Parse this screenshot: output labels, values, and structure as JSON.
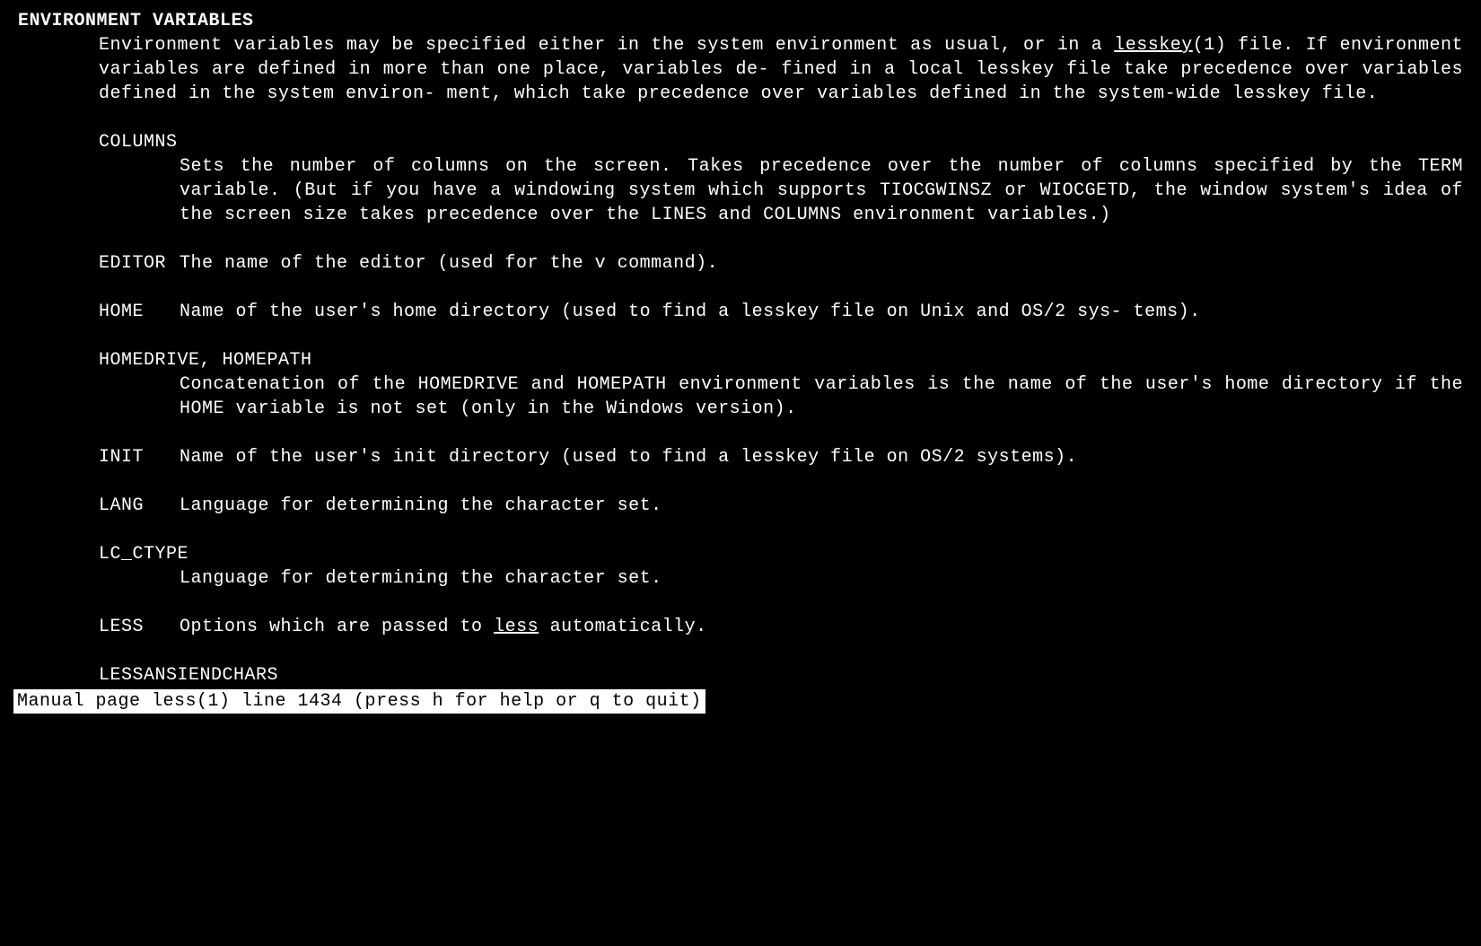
{
  "section_header": "ENVIRONMENT VARIABLES",
  "intro": {
    "part1": "Environment variables may be specified either in the system environment as  usual,  or  in  a  ",
    "link": "lesskey",
    "linknum": "(1)",
    "part2": "  file.  If environment variables are defined in more than one place, variables de‐ fined in a local lesskey file take precedence over variables defined in the  system  environ‐ ment, which take precedence over variables defined in the system-wide lesskey file."
  },
  "vars": {
    "columns": {
      "name": "COLUMNS",
      "desc": "Sets the number of columns on the screen.  Takes precedence over the number of columns specified  by  the  TERM variable.  (But if you have a windowing system which supports TIOCGWINSZ or WIOCGETD, the window system's idea of the screen size  takes  precedence over the LINES and COLUMNS environment variables.)"
    },
    "editor": {
      "name": "EDITOR",
      "desc": "The name of the editor (used for the v command)."
    },
    "home": {
      "name": "HOME",
      "desc": "Name  of  the user's home directory (used to find a lesskey file on Unix and OS/2 sys‐ tems)."
    },
    "homedrive": {
      "name": "HOMEDRIVE, HOMEPATH",
      "desc": "Concatenation of the HOMEDRIVE and HOMEPATH environment variables is the name  of  the user's home directory if the HOME variable is not set (only in the Windows version)."
    },
    "init": {
      "name": "INIT",
      "desc": "Name of the user's init directory (used to find a lesskey file on OS/2 systems)."
    },
    "lang": {
      "name": "LANG",
      "desc": "Language for determining the character set."
    },
    "lc_ctype": {
      "name": "LC_CTYPE",
      "desc": "Language for determining the character set."
    },
    "less": {
      "name": "LESS",
      "desc_pre": "Options which are passed to ",
      "desc_link": "less",
      "desc_post": " automatically."
    },
    "lessansiendchars": {
      "name": "LESSANSIENDCHARS"
    }
  },
  "status_bar": " Manual page less(1) line 1434 (press h for help or q to quit) "
}
